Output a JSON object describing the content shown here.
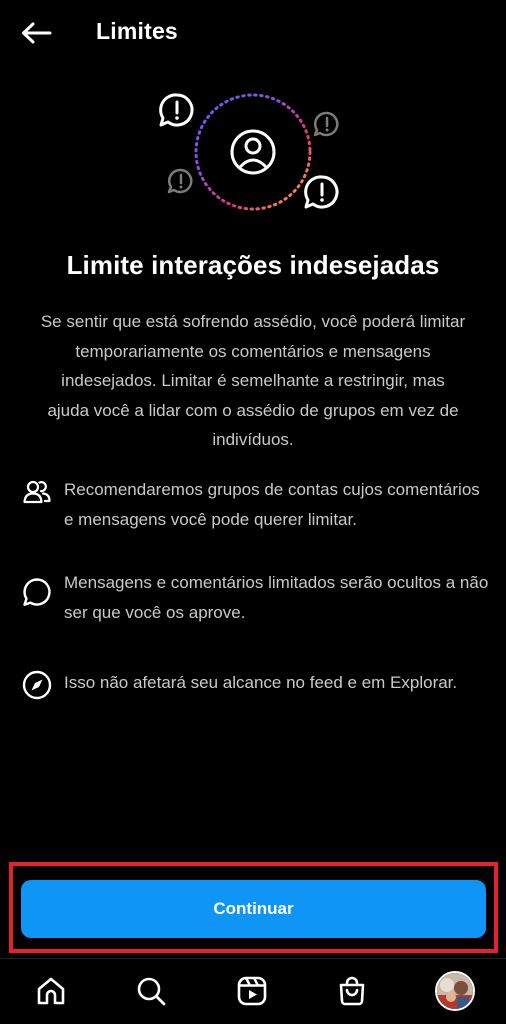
{
  "header": {
    "title": "Limites",
    "back_icon": "arrow-left-icon"
  },
  "hero": {
    "title": "Limite interações indesejadas",
    "description": "Se sentir que está sofrendo assédio, você poderá limitar temporariamente os comentários e mensagens indesejados. Limitar é semelhante a restringir, mas ajuda você a lidar com o assédio de grupos em vez de indivíduos."
  },
  "features": [
    {
      "icon": "people-icon",
      "text": "Recomendaremos grupos de contas cujos comentários e mensagens você pode querer limitar."
    },
    {
      "icon": "speech-bubble-icon",
      "text": "Mensagens e comentários limitados serão ocultos a não ser que você os aprove."
    },
    {
      "icon": "compass-icon",
      "text": "Isso não afetará seu alcance no feed e em Explorar."
    }
  ],
  "actions": {
    "continue_label": "Continuar"
  },
  "bottom_nav": {
    "items": [
      "home-icon",
      "search-icon",
      "reels-icon",
      "shop-icon",
      "profile-avatar"
    ]
  },
  "colors": {
    "background": "#000000",
    "primary_button": "#0f95f6",
    "highlight": "#e5212e",
    "secondary_text": "#c9c9c9"
  }
}
